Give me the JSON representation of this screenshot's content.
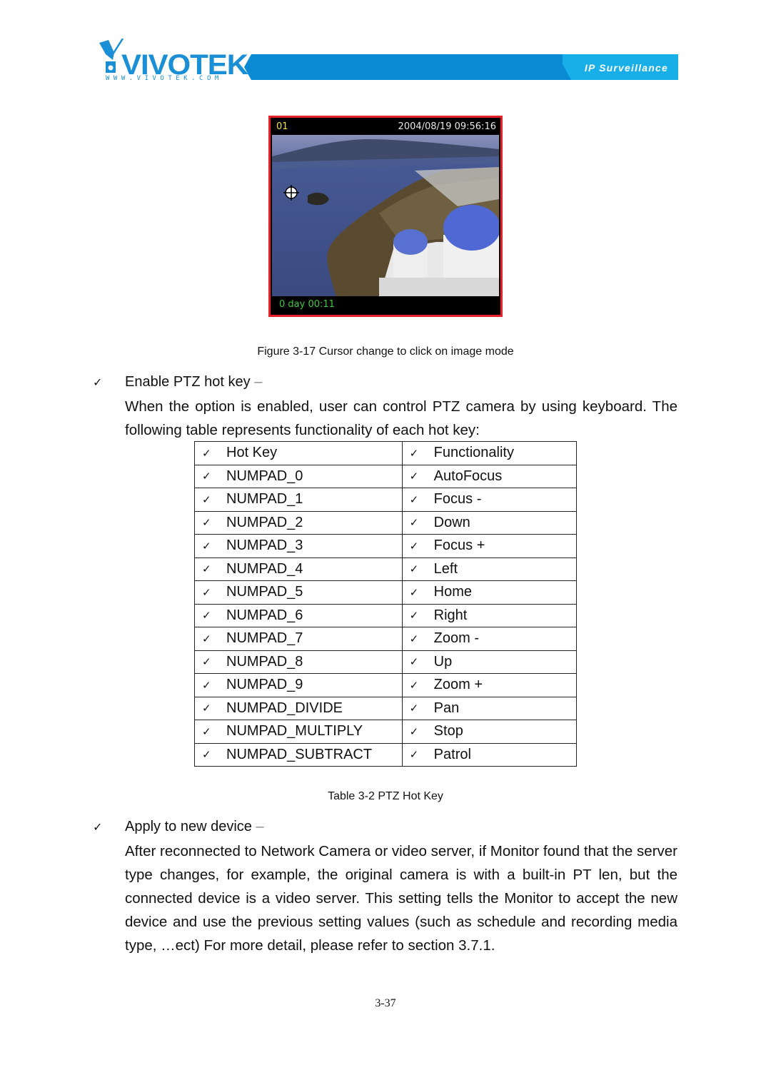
{
  "header": {
    "brand": "VIVOTEK",
    "brand_url": "WWW.VIVOTEK.COM",
    "tagline": "IP Surveillance",
    "brand_color": "#1a8fd6",
    "band_color": "#0a8ad2",
    "band_light_color": "#18aee8"
  },
  "figure": {
    "camera_id": "01",
    "timestamp": "2004/08/19 09:56:16",
    "elapsed": "0 day  00:11",
    "cursor_icon": "crosshair-cursor-icon",
    "border_color": "#e8202a",
    "caption": "Figure 3-17 Cursor change to click on image mode"
  },
  "section_ptz": {
    "bullet": "✓",
    "title": "Enable PTZ hot key",
    "dash": "–",
    "description": "When the option is enabled, user can control PTZ camera by using keyboard. The following table represents functionality of each hot key:"
  },
  "table": {
    "headers": [
      "Hot Key",
      "Functionality"
    ],
    "check": "✓",
    "rows": [
      [
        "NUMPAD_0",
        "AutoFocus"
      ],
      [
        "NUMPAD_1",
        "Focus -"
      ],
      [
        "NUMPAD_2",
        "Down"
      ],
      [
        "NUMPAD_3",
        "Focus +"
      ],
      [
        "NUMPAD_4",
        "Left"
      ],
      [
        "NUMPAD_5",
        "Home"
      ],
      [
        "NUMPAD_6",
        "Right"
      ],
      [
        "NUMPAD_7",
        "Zoom -"
      ],
      [
        "NUMPAD_8",
        "Up"
      ],
      [
        "NUMPAD_9",
        "Zoom +"
      ],
      [
        "NUMPAD_DIVIDE",
        "Pan"
      ],
      [
        "NUMPAD_MULTIPLY",
        "Stop"
      ],
      [
        "NUMPAD_SUBTRACT",
        "Patrol"
      ]
    ],
    "caption": "Table 3-2 PTZ Hot Key"
  },
  "section_apply": {
    "bullet": "✓",
    "title": "Apply to new device",
    "dash": "–",
    "description": "After reconnected to Network Camera or video server, if Monitor found that the server type changes, for example, the original camera is with a built-in PT len, but the connected device is a video server. This setting tells the Monitor to accept the new device and use the previous setting values (such as schedule and recording media type, …ect) For more detail, please refer to section 3.7.1."
  },
  "page_number": "3-37"
}
